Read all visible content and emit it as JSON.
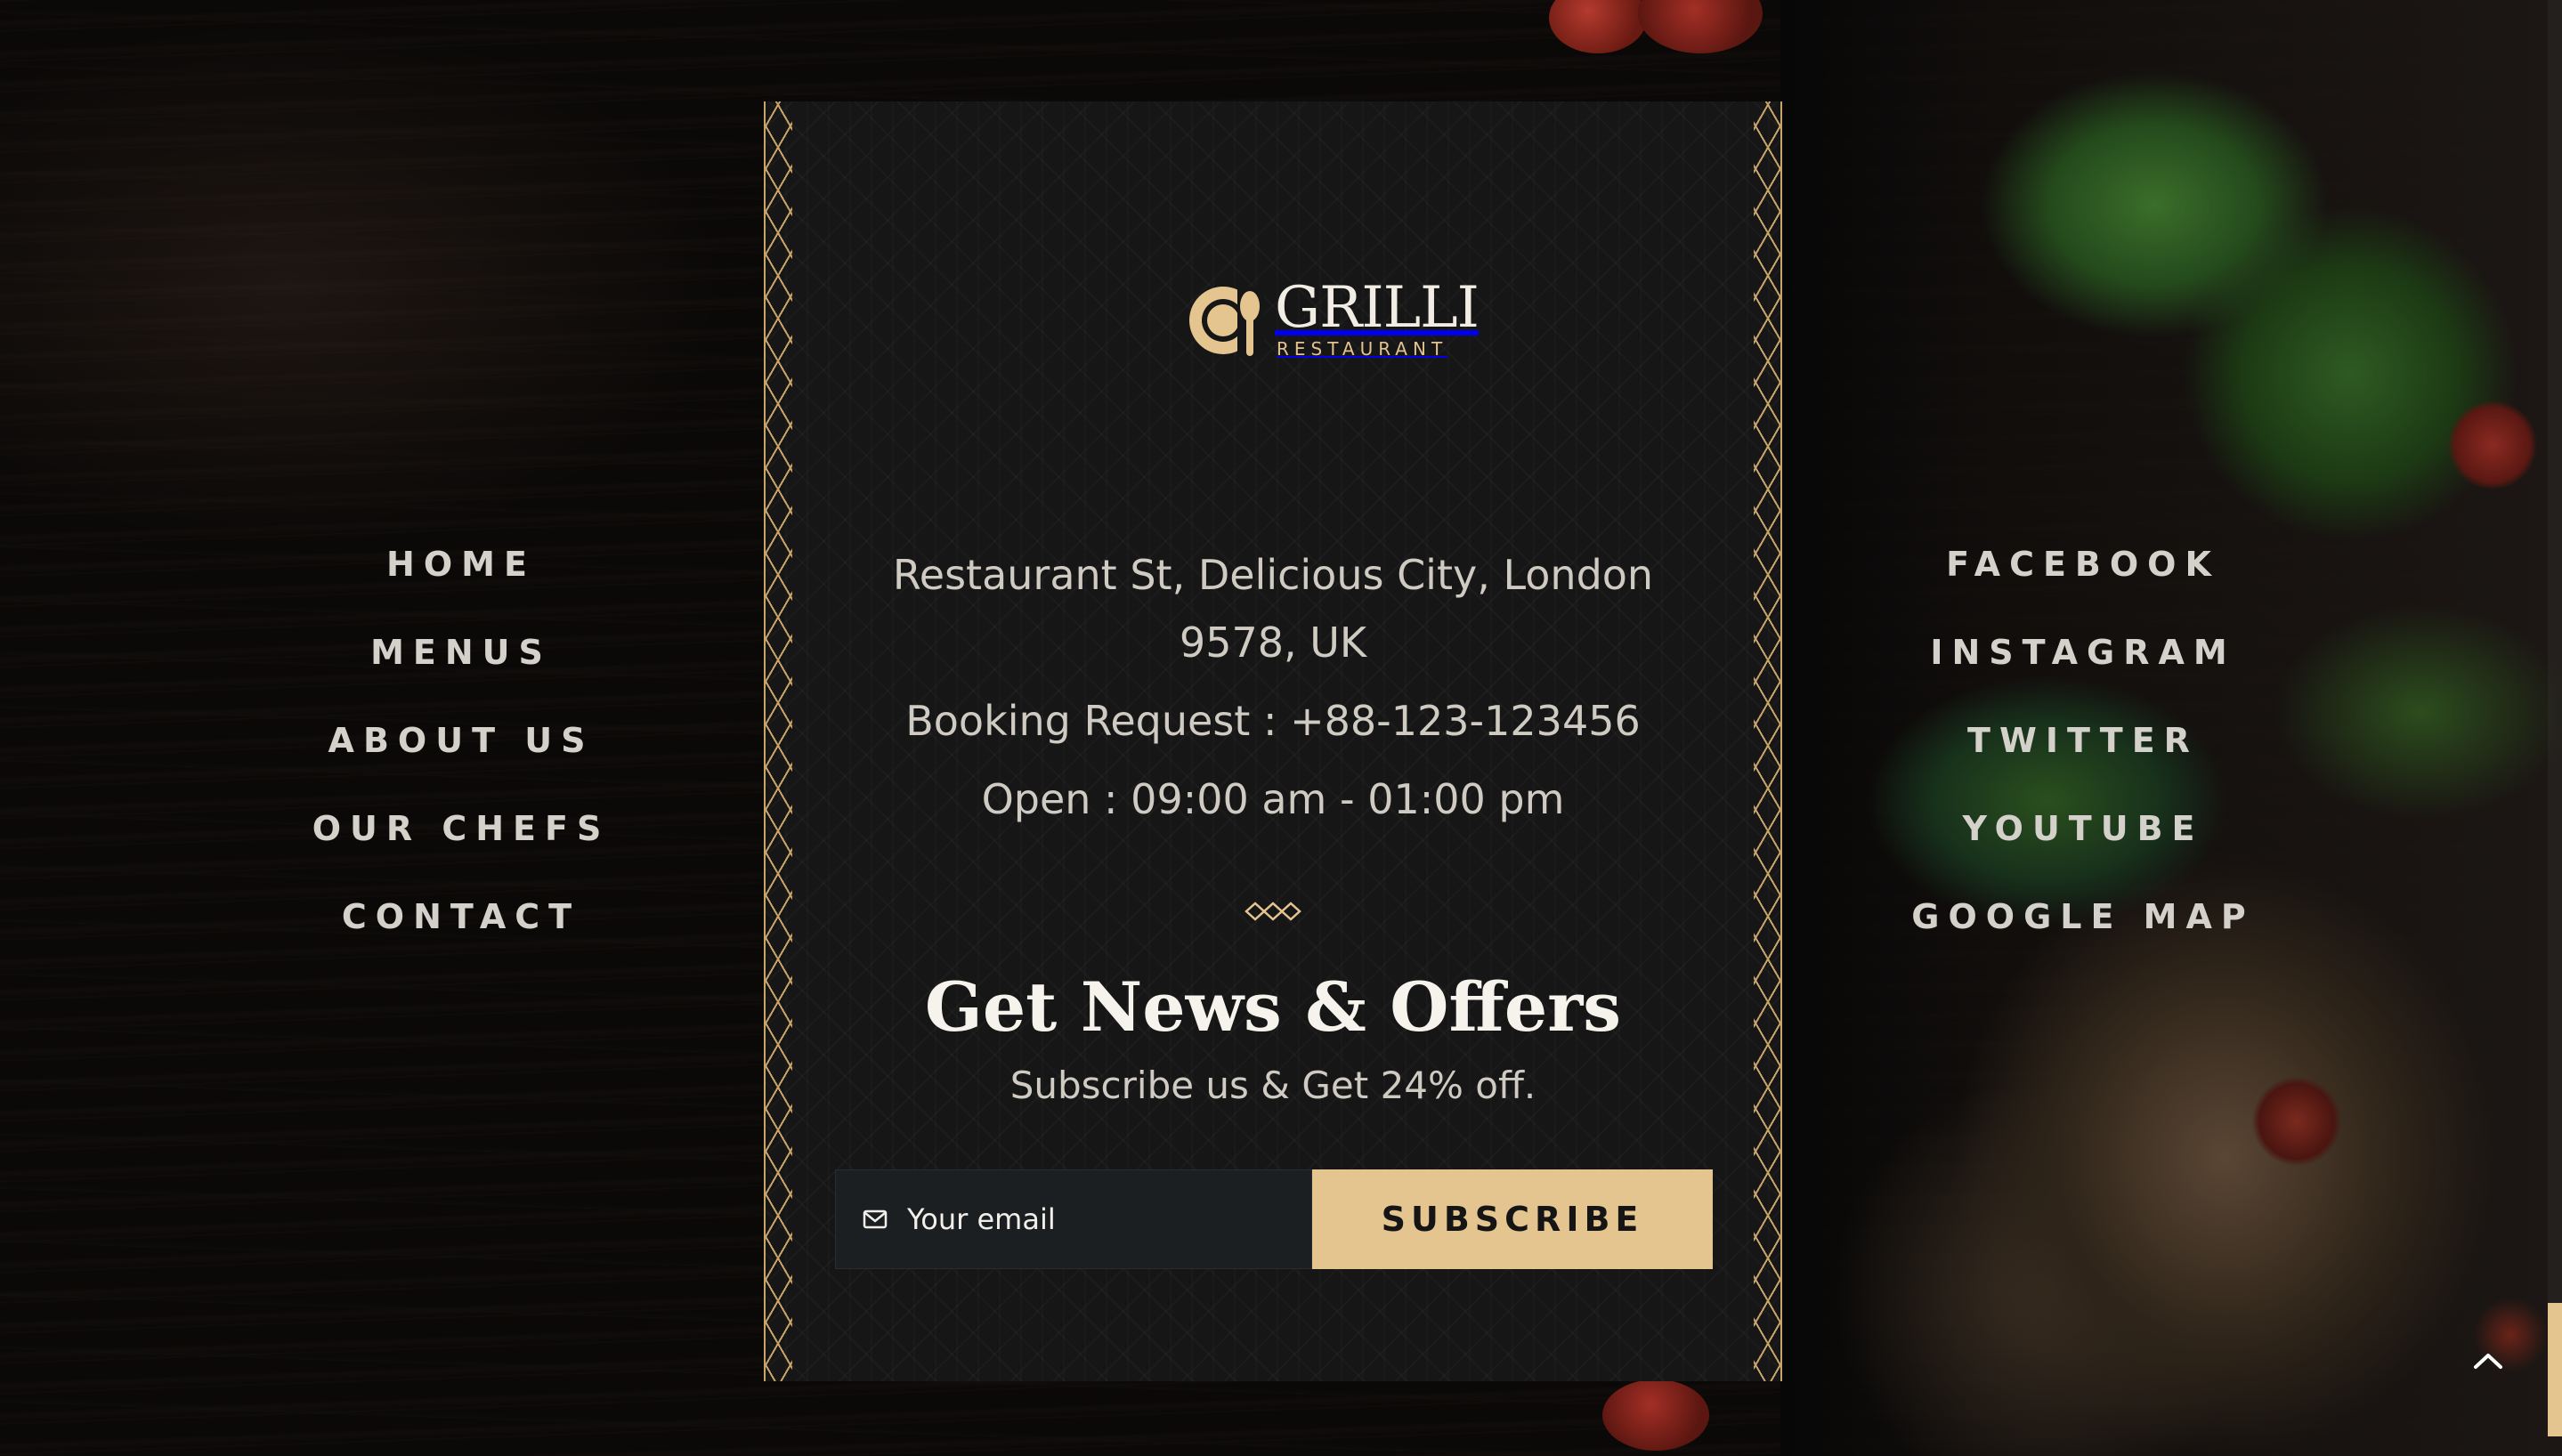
{
  "brand": {
    "name": "GRILLI",
    "tagline": "RESTAURANT",
    "accent_color": "#e5c58f"
  },
  "left_nav": {
    "items": [
      {
        "label": "HOME"
      },
      {
        "label": "MENUS"
      },
      {
        "label": "ABOUT US"
      },
      {
        "label": "OUR CHEFS"
      },
      {
        "label": "CONTACT"
      }
    ]
  },
  "social_nav": {
    "items": [
      {
        "label": "FACEBOOK"
      },
      {
        "label": "INSTAGRAM"
      },
      {
        "label": "TWITTER"
      },
      {
        "label": "YOUTUBE"
      },
      {
        "label": "GOOGLE MAP"
      }
    ]
  },
  "contact": {
    "address": "Restaurant St, Delicious City, London 9578, UK",
    "booking": "Booking Request : +88-123-123456",
    "hours": "Open : 09:00 am - 01:00 pm"
  },
  "newsletter": {
    "title": "Get News & Offers",
    "subtitle": "Subscribe us & Get 24% off.",
    "email_placeholder": "Your email",
    "email_icon": "mail-icon",
    "button_label": "SUBSCRIBE"
  },
  "scroll_top": {
    "icon": "chevron-up-icon"
  }
}
